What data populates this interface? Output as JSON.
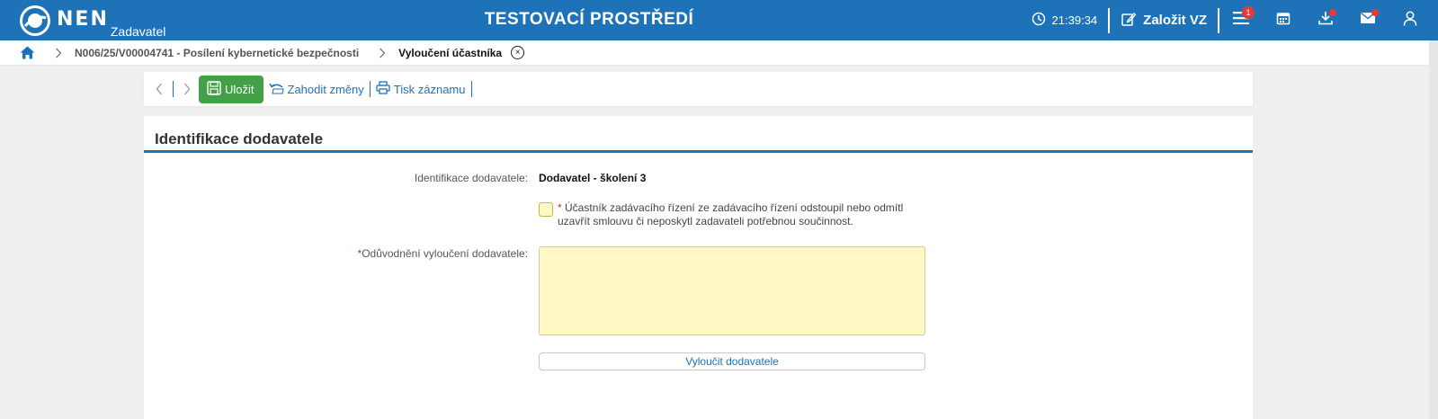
{
  "header": {
    "logo_text": "NEN",
    "logo_sub": "Zadavatel",
    "title": "TESTOVACÍ PROSTŘEDÍ",
    "clock": "21:39:34",
    "create_label": "Založit VZ",
    "menu_badge": "1",
    "icons": [
      "clock-icon",
      "edit-icon",
      "menu-icon",
      "calendar-icon",
      "download-icon",
      "mail-icon",
      "user-icon"
    ],
    "color": "#1e73b8"
  },
  "breadcrumb": {
    "items": [
      {
        "label": "N006/25/V00004741 - Posílení kybernetické bezpečnosti"
      },
      {
        "label": "Vyloučení účastníka"
      }
    ]
  },
  "toolbar": {
    "save_label": "Uložit",
    "discard_label": "Zahodit změny",
    "print_label": "Tisk záznamu",
    "save_color": "#43a047"
  },
  "section": {
    "title": "Identifikace dodavatele",
    "supplier_label": "Identifikace dodavatele:",
    "supplier_value": "Dodavatel - školení 3",
    "checkbox_required": "*",
    "checkbox_label": "Účastník zadávacího řízení ze zadávacího řízení odstoupil nebo odmítl uzavřít smlouvu či neposkytl zadavateli potřebnou součinnost.",
    "reason_required": "*",
    "reason_label": "Odůvodnění vyloučení dodavatele:",
    "reason_value": "",
    "exclude_button": "Vyloučit dodavatele"
  }
}
